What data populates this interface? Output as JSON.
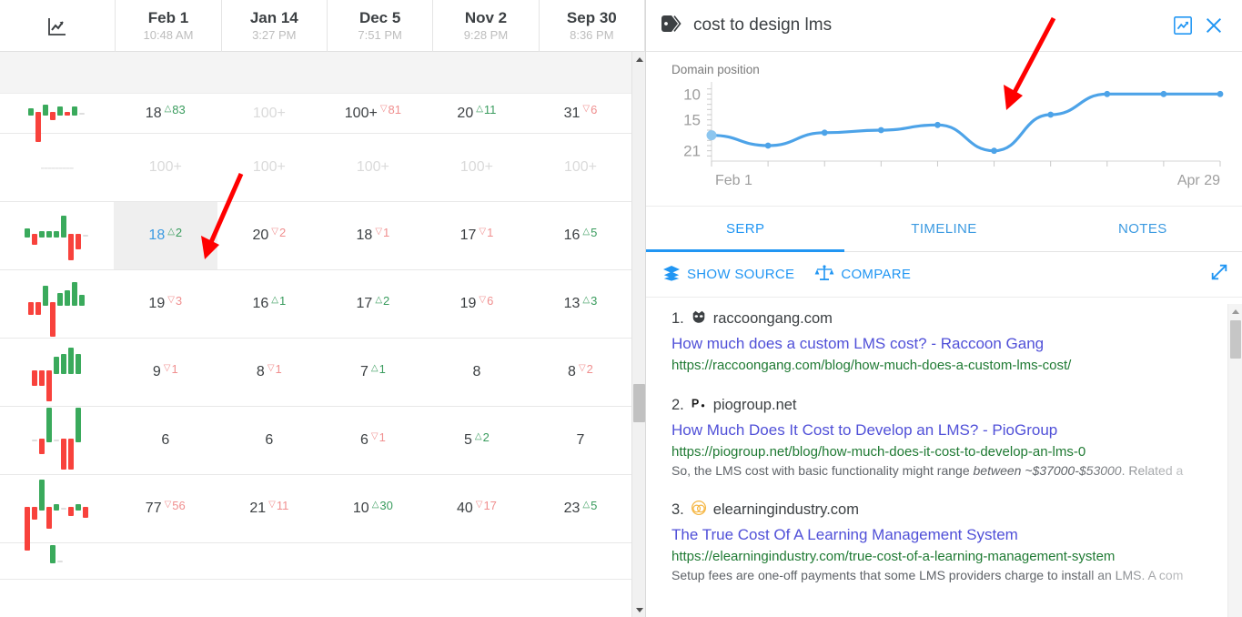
{
  "table": {
    "leading_icon": "line-chart-icon",
    "columns": [
      {
        "date": "Feb 1",
        "time": "10:48 AM"
      },
      {
        "date": "Jan 14",
        "time": "3:27 PM"
      },
      {
        "date": "Dec 5",
        "time": "7:51 PM"
      },
      {
        "date": "Nov 2",
        "time": "9:28 PM"
      },
      {
        "date": "Sep 30",
        "time": "8:36 PM"
      }
    ],
    "rows": [
      {
        "spark": [
          3,
          -14,
          5,
          -4,
          4,
          -2,
          4,
          0
        ],
        "cells": [
          {
            "value": "18",
            "delta": "83",
            "dir": "up",
            "selected": false
          },
          {
            "value": "100+",
            "delta": "",
            "dir": "none",
            "faded": true
          },
          {
            "value": "100+",
            "delta": "81",
            "dir": "down"
          },
          {
            "value": "20",
            "delta": "11",
            "dir": "up"
          },
          {
            "value": "31",
            "delta": "6",
            "dir": "down"
          }
        ]
      },
      {
        "spark": [],
        "dashes": "---------",
        "cells": [
          {
            "value": "100+",
            "delta": "",
            "dir": "none",
            "faded": true
          },
          {
            "value": "100+",
            "delta": "",
            "dir": "none",
            "faded": true
          },
          {
            "value": "100+",
            "delta": "",
            "dir": "none",
            "faded": true
          },
          {
            "value": "100+",
            "delta": "",
            "dir": "none",
            "faded": true
          },
          {
            "value": "100+",
            "delta": "",
            "dir": "none",
            "faded": true
          }
        ]
      },
      {
        "spark": [
          4,
          -5,
          3,
          3,
          3,
          10,
          -12,
          -7,
          0
        ],
        "cells": [
          {
            "value": "18",
            "delta": "2",
            "dir": "up",
            "selected": true,
            "blue": true
          },
          {
            "value": "20",
            "delta": "2",
            "dir": "down"
          },
          {
            "value": "18",
            "delta": "1",
            "dir": "down"
          },
          {
            "value": "17",
            "delta": "1",
            "dir": "down"
          },
          {
            "value": "16",
            "delta": "5",
            "dir": "up"
          }
        ]
      },
      {
        "spark": [
          -6,
          -6,
          9,
          -16,
          6,
          7,
          11,
          5
        ],
        "cells": [
          {
            "value": "19",
            "delta": "3",
            "dir": "down"
          },
          {
            "value": "16",
            "delta": "1",
            "dir": "up"
          },
          {
            "value": "17",
            "delta": "2",
            "dir": "up"
          },
          {
            "value": "19",
            "delta": "6",
            "dir": "down"
          },
          {
            "value": "13",
            "delta": "3",
            "dir": "up"
          }
        ]
      },
      {
        "spark": [
          -7,
          -7,
          -14,
          8,
          9,
          12,
          9
        ],
        "cells": [
          {
            "value": "9",
            "delta": "1",
            "dir": "down"
          },
          {
            "value": "8",
            "delta": "1",
            "dir": "down"
          },
          {
            "value": "7",
            "delta": "1",
            "dir": "up"
          },
          {
            "value": "8",
            "delta": "",
            "dir": "none"
          },
          {
            "value": "8",
            "delta": "2",
            "dir": "down"
          }
        ]
      },
      {
        "spark": [
          0,
          -7,
          16,
          0,
          -14,
          -14,
          16
        ],
        "cells": [
          {
            "value": "6",
            "delta": "",
            "dir": "none"
          },
          {
            "value": "6",
            "delta": "",
            "dir": "none"
          },
          {
            "value": "6",
            "delta": "1",
            "dir": "down"
          },
          {
            "value": "5",
            "delta": "2",
            "dir": "up"
          },
          {
            "value": "7",
            "delta": "",
            "dir": "none"
          }
        ]
      },
      {
        "spark": [
          -20,
          -6,
          14,
          -10,
          3,
          0,
          -4,
          3,
          -5
        ],
        "cells": [
          {
            "value": "77",
            "delta": "56",
            "dir": "down"
          },
          {
            "value": "21",
            "delta": "11",
            "dir": "down"
          },
          {
            "value": "10",
            "delta": "30",
            "dir": "up"
          },
          {
            "value": "40",
            "delta": "17",
            "dir": "down"
          },
          {
            "value": "23",
            "delta": "5",
            "dir": "up"
          }
        ]
      },
      {
        "spark": [
          8,
          0
        ],
        "cells": [
          {
            "value": "",
            "delta": "",
            "dir": "none"
          },
          {
            "value": "",
            "delta": "",
            "dir": "none"
          },
          {
            "value": "",
            "delta": "",
            "dir": "none"
          },
          {
            "value": "",
            "delta": "",
            "dir": "none"
          },
          {
            "value": "",
            "delta": "",
            "dir": "none"
          }
        ]
      }
    ]
  },
  "panel": {
    "title": "cost to design lms",
    "tag_icon": "tag-icon",
    "chart_toggle_icon": "line-chart-icon",
    "close_icon": "close-icon",
    "tabs": [
      {
        "label": "SERP",
        "active": true
      },
      {
        "label": "TIMELINE",
        "active": false
      },
      {
        "label": "NOTES",
        "active": false
      }
    ],
    "actions": {
      "show_source": "SHOW SOURCE",
      "show_source_icon": "layers-icon",
      "compare": "COMPARE",
      "compare_icon": "scales-icon",
      "expand_icon": "expand-arrows-icon"
    },
    "serp_results": [
      {
        "rank": "1.",
        "favicon": "raccoon-icon",
        "favicon_color": "#3c4043",
        "domain": "raccoongang.com",
        "title": "How much does a custom LMS cost? - Raccoon Gang",
        "url": "https://raccoongang.com/blog/how-much-does-a-custom-lms-cost/",
        "snippet": ""
      },
      {
        "rank": "2.",
        "favicon": "piogroup-icon",
        "favicon_color": "#1a1a1a",
        "domain": "piogroup.net",
        "title": "How Much Does It Cost to Develop an LMS? - PioGroup",
        "url": "https://piogroup.net/blog/how-much-does-it-cost-to-develop-an-lms-0",
        "snippet_pre": "So, the LMS cost with basic functionality might range ",
        "snippet_em": "between ~$37000-$53000",
        "snippet_post": ". Related a"
      },
      {
        "rank": "3.",
        "favicon": "elearning-icon",
        "favicon_color": "#f5b642",
        "domain": "elearningindustry.com",
        "title": "The True Cost Of A Learning Management System",
        "url": "https://elearningindustry.com/true-cost-of-a-learning-management-system",
        "snippet": "Setup fees are one-off payments that some LMS providers charge to install an LMS. A com"
      }
    ]
  },
  "chart_data": {
    "type": "line",
    "title": "Domain position",
    "ylabel": "",
    "xlabel": "",
    "x": [
      "Feb 1",
      "",
      "",
      "",
      "",
      "",
      "",
      "",
      "",
      "Apr 29"
    ],
    "tick_labels": [
      "Feb 1",
      "Apr 29"
    ],
    "ytick_labels": [
      "10",
      "15",
      "21"
    ],
    "yticks": [
      10,
      15,
      21
    ],
    "ylim": [
      23,
      8
    ],
    "inverted_y": true,
    "grid": false,
    "legend": false,
    "series": [
      {
        "name": "Domain position",
        "color": "#4da3e8",
        "values": [
          18,
          20,
          17.5,
          17,
          16,
          21,
          14,
          10,
          10,
          10
        ]
      }
    ]
  },
  "annotations": {
    "arrow_color": "#ff0000",
    "arrows": 2
  },
  "colors": {
    "accent": "#2196f3",
    "link": "#5050d8",
    "url_green": "#1f7a33",
    "up_green": "#3a9c5e",
    "down_red": "#f08f8f",
    "selected_cell_bg": "#efefef"
  }
}
